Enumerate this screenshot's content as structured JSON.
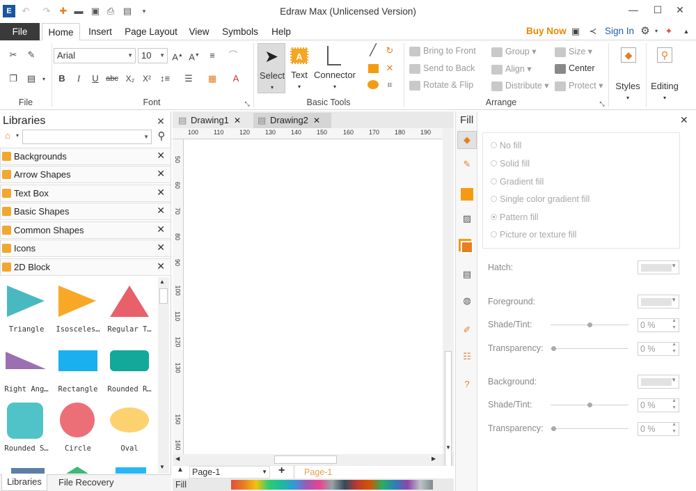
{
  "app": {
    "title": "Edraw Max (Unlicensed Version)"
  },
  "quick_access": [
    "app-logo-icon",
    "undo-icon",
    "redo-icon",
    "new-file-icon",
    "open-folder-icon",
    "save-icon",
    "print-icon",
    "export-icon",
    "customize-icon"
  ],
  "ribbon_tabs": {
    "file": "File",
    "tabs": [
      "Home",
      "Insert",
      "Page Layout",
      "View",
      "Symbols",
      "Help"
    ],
    "active": "Home"
  },
  "account": {
    "buy_now": "Buy Now",
    "sign_in": "Sign In"
  },
  "file_group": {
    "label": "File"
  },
  "font_group": {
    "family": "Arial",
    "size": "10",
    "label": "Font"
  },
  "basic_tools": {
    "select": "Select",
    "text": "Text",
    "connector": "Connector",
    "label": "Basic Tools"
  },
  "arrange": {
    "items": [
      "Bring to Front",
      "Send to Back",
      "Rotate & Flip",
      "Group",
      "Align",
      "Distribute",
      "Size",
      "Center",
      "Protect"
    ],
    "label": "Arrange"
  },
  "styles": {
    "label": "Styles"
  },
  "editing": {
    "label": "Editing"
  },
  "libraries": {
    "title": "Libraries",
    "items": [
      "Backgrounds",
      "Arrow Shapes",
      "Text Box",
      "Basic Shapes",
      "Common Shapes",
      "Icons",
      "2D Block"
    ],
    "shapes": [
      "Triangle",
      "Isosceles…",
      "Regular T…",
      "Right Ang…",
      "Rectangle",
      "Rounded R…",
      "Rounded S…",
      "Circle",
      "Oval"
    ],
    "colors": {
      "teal": "#4ab8c1",
      "orange": "#f9a825",
      "red": "#e8606a",
      "purple": "#9b6fb0",
      "blue": "#1ab0f0",
      "green": "#12a89a",
      "coral": "#ec6f78",
      "yellow": "#fcd271"
    }
  },
  "bottom_tabs": {
    "libraries": "Libraries",
    "file_recovery": "File Recovery"
  },
  "documents": {
    "tabs": [
      "Drawing1",
      "Drawing2"
    ],
    "active": "Drawing2"
  },
  "ruler": {
    "h": [
      "100",
      "110",
      "120",
      "130",
      "140",
      "150",
      "160",
      "170",
      "180",
      "190"
    ],
    "v": [
      "50",
      "60",
      "70",
      "80",
      "90",
      "100",
      "110",
      "120",
      "130",
      "150",
      "160"
    ]
  },
  "pages": {
    "current": "Page-1",
    "tab": "Page-1",
    "fill_label": "Fill"
  },
  "fill_panel": {
    "title": "Fill",
    "options": [
      "No fill",
      "Solid fill",
      "Gradient fill",
      "Single color gradient fill",
      "Pattern fill",
      "Picture or texture fill"
    ],
    "selected": "Pattern fill",
    "hatch": "Hatch:",
    "foreground": "Foreground:",
    "background": "Background:",
    "shade": "Shade/Tint:",
    "transparency": "Transparency:",
    "fg_shade": "0 %",
    "fg_trans": "0 %",
    "bg_shade": "0 %",
    "bg_trans": "0 %"
  }
}
